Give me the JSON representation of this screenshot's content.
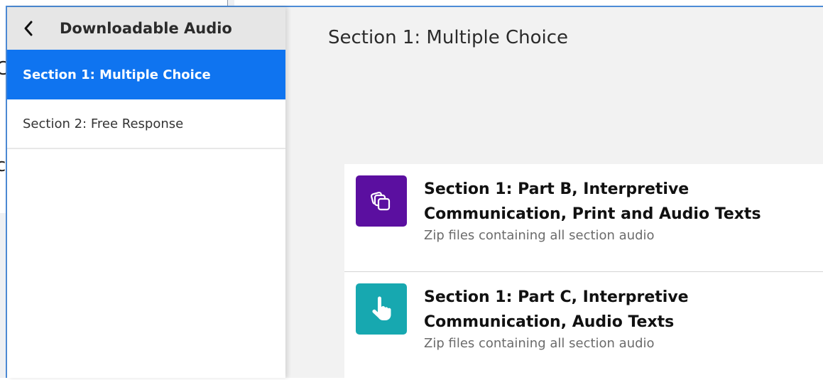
{
  "background": {
    "glyphs": [
      "C",
      "c"
    ]
  },
  "sidebar": {
    "title": "Downloadable Audio",
    "back_icon": "chevron-left-icon",
    "items": [
      {
        "label": "Section 1: Multiple Choice",
        "active": true
      },
      {
        "label": "Section 2: Free Response",
        "active": false
      }
    ]
  },
  "main": {
    "title": "Section 1: Multiple Choice",
    "cards": [
      {
        "title": "Section 1: Part B, Interpretive Communication, Print and Audio Texts",
        "subtitle": "Zip files containing all section audio",
        "icon": "stacked-cards-icon",
        "icon_color": "#5b0fa0"
      },
      {
        "title": "Section 1: Part C, Interpretive Communication, Audio Texts",
        "subtitle": "Zip files containing all section audio",
        "icon": "pointing-hand-icon",
        "icon_color": "#17a8b0"
      }
    ]
  },
  "colors": {
    "accent": "#0f74f0",
    "window_border": "#4d8bd6"
  }
}
